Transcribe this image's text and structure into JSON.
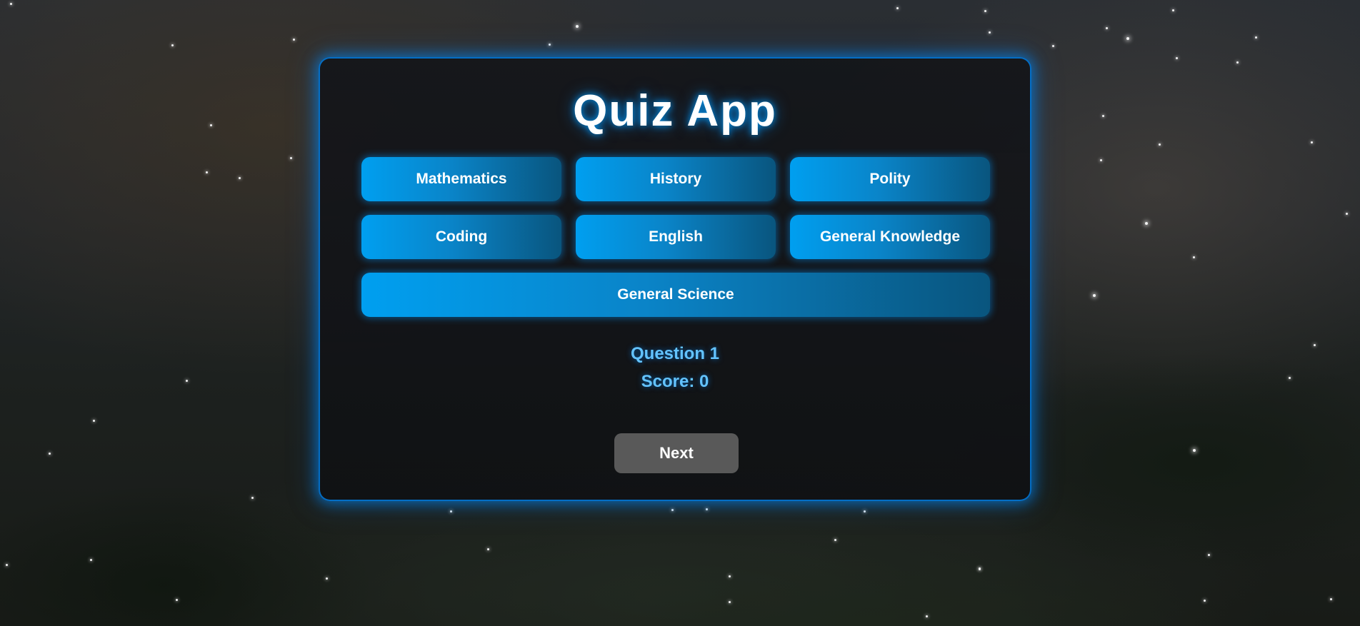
{
  "app": {
    "title": "Quiz App"
  },
  "categories": [
    {
      "label": "Mathematics"
    },
    {
      "label": "History"
    },
    {
      "label": "Polity"
    },
    {
      "label": "Coding"
    },
    {
      "label": "English"
    },
    {
      "label": "General Knowledge"
    },
    {
      "label": "General Science"
    }
  ],
  "status": {
    "question": "Question 1",
    "score": "Score: 0"
  },
  "controls": {
    "next_label": "Next"
  },
  "colors": {
    "accent": "#009ff0",
    "glow": "#008cff",
    "status_text": "#63c3ff",
    "next_button": "#595959"
  }
}
